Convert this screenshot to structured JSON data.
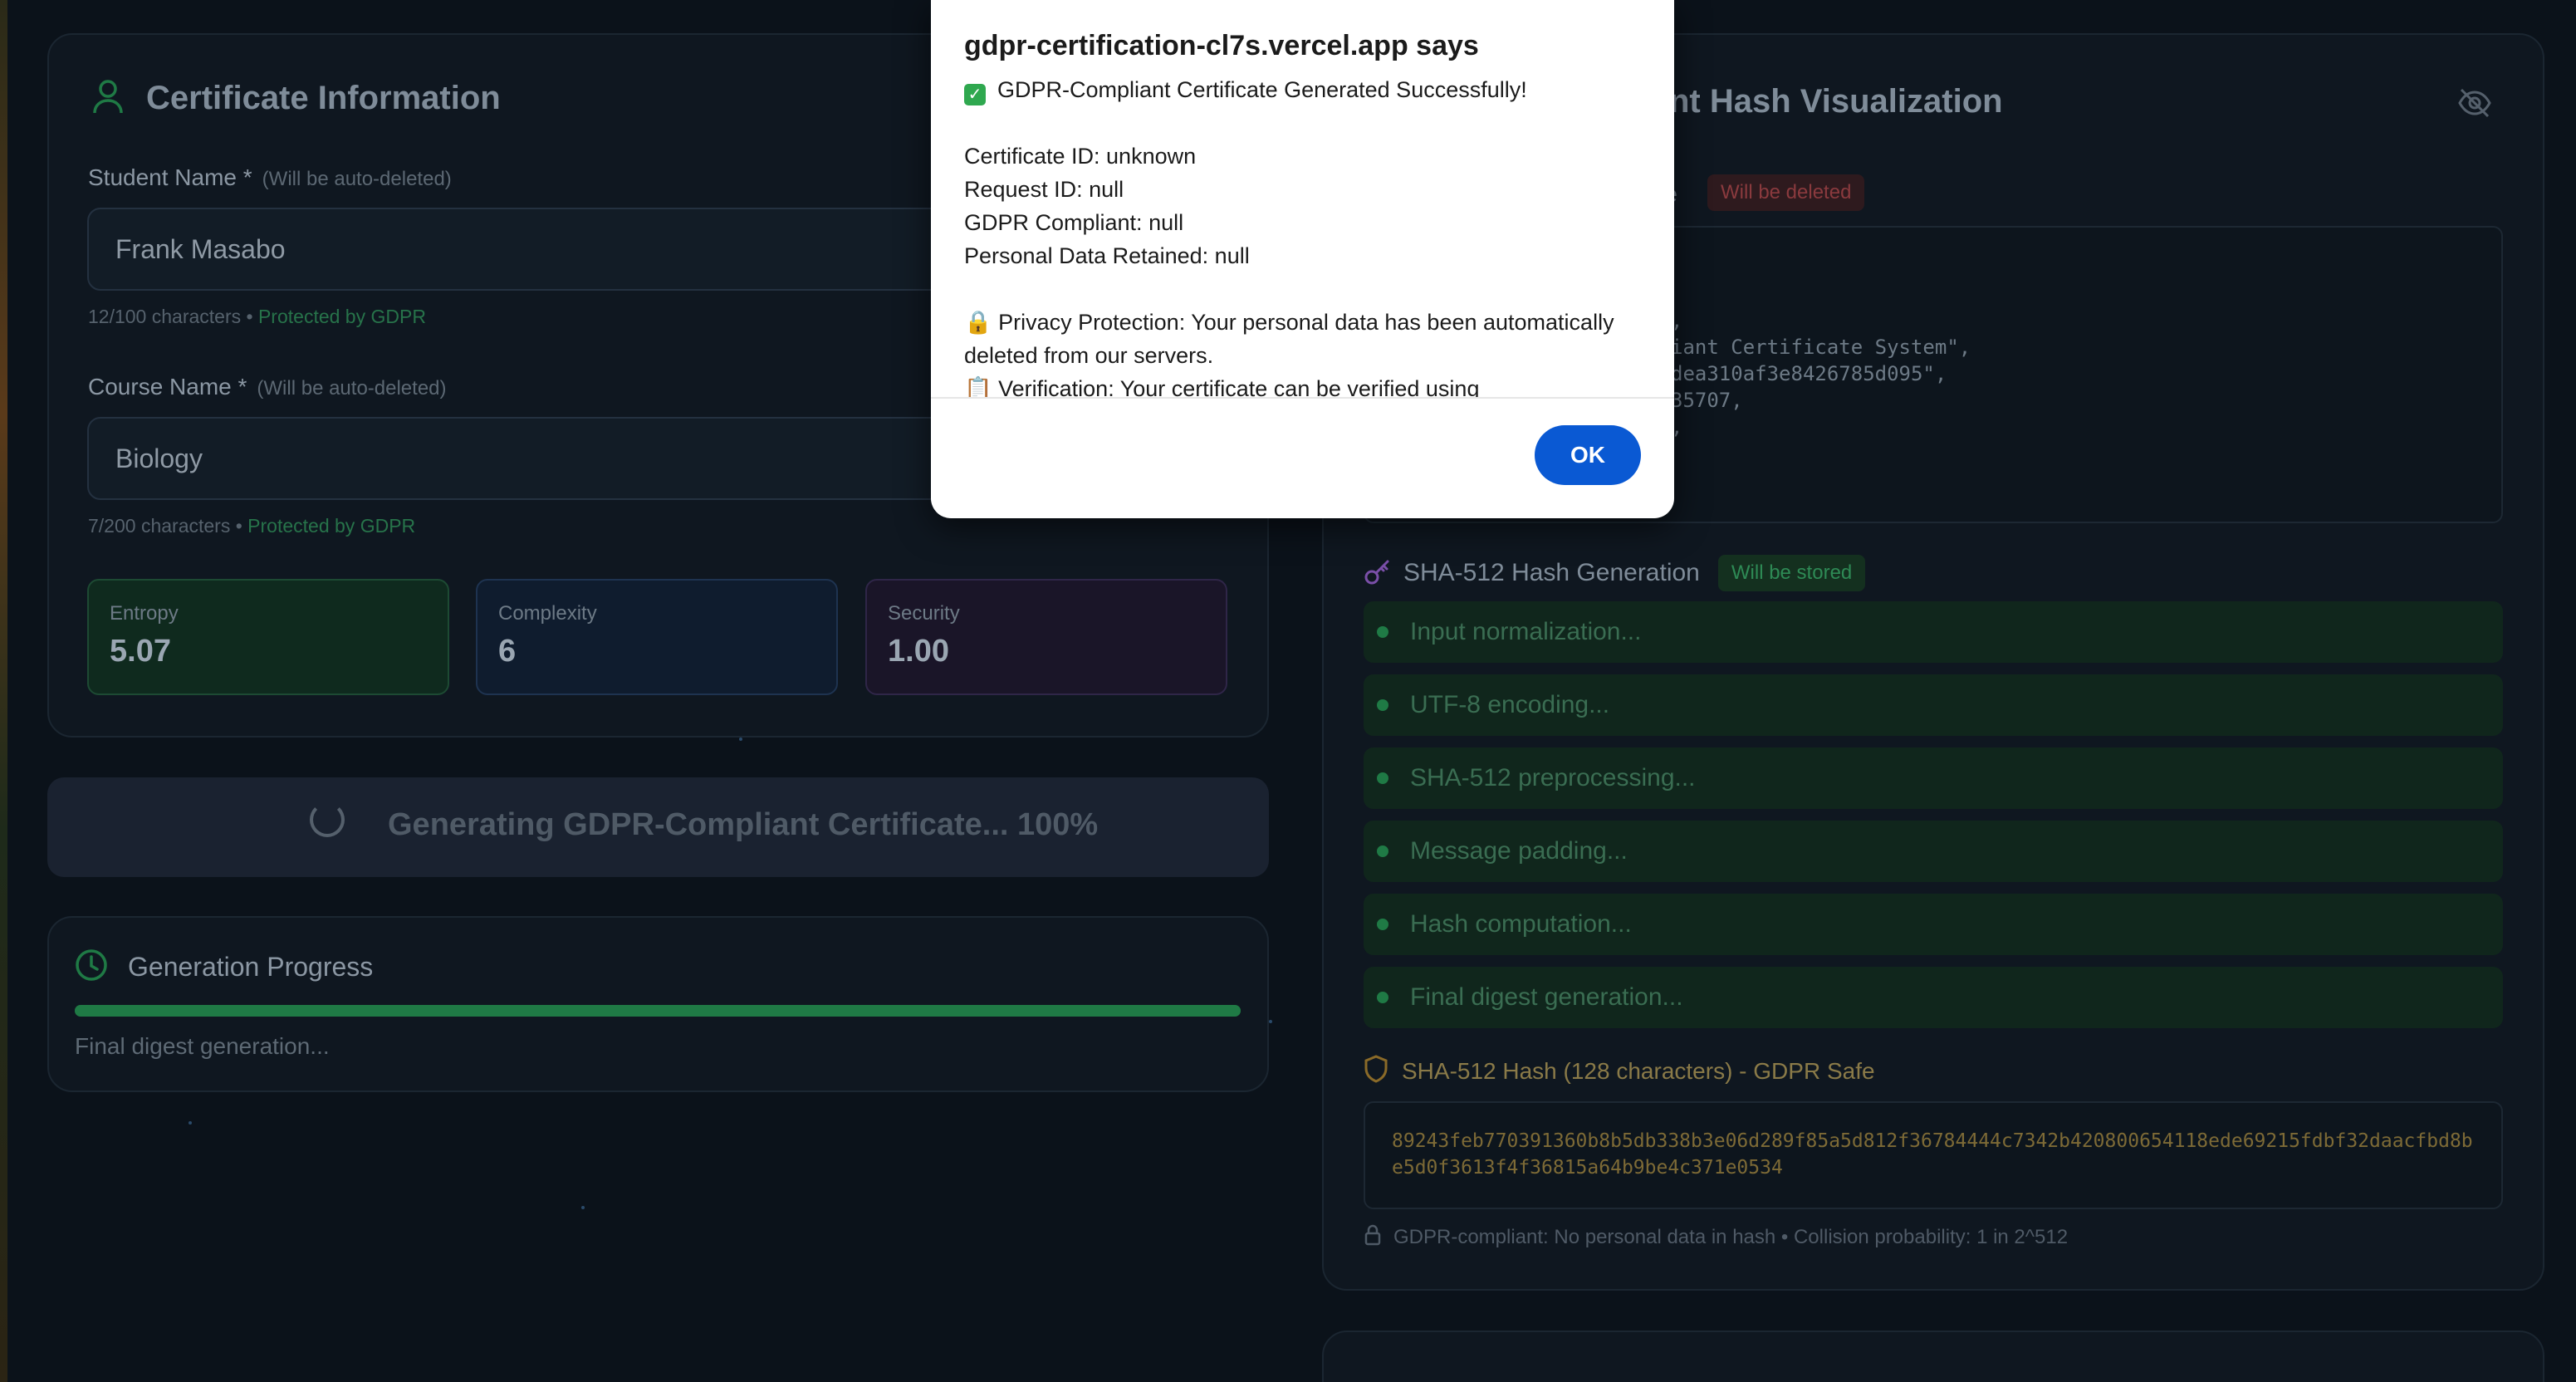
{
  "dialog": {
    "title": "gdpr-certification-cl7s.vercel.app says",
    "success_line": "GDPR-Compliant Certificate Generated Successfully!",
    "lines": [
      "Certificate ID: unknown",
      "Request ID: null",
      "GDPR Compliant: null",
      "Personal Data Retained: null"
    ],
    "privacy_line_1": "🔒 Privacy Protection: Your personal data has been automatically",
    "privacy_line_2": "deleted from our servers.",
    "verification_line": "📋 Verification: Your certificate can be verified using",
    "ok_label": "OK"
  },
  "cert_info": {
    "title": "Certificate Information",
    "student_label": "Student Name *",
    "student_hint": "(Will be auto-deleted)",
    "student_value": "Frank Masabo",
    "student_count": "12/100 characters",
    "student_protect": "Protected by GDPR",
    "course_label": "Course Name *",
    "course_hint": "(Will be auto-deleted)",
    "course_value": "Biology",
    "course_count": "7/200 characters",
    "course_protect": "Protected by GDPR",
    "separator": "•",
    "metrics": [
      {
        "label": "Entropy",
        "value": "5.07"
      },
      {
        "label": "Complexity",
        "value": "6"
      },
      {
        "label": "Security",
        "value": "1.00"
      }
    ]
  },
  "generate_button": {
    "label": "Generating GDPR-Compliant Certificate... 100%"
  },
  "progress": {
    "title": "Generation Progress",
    "status": "Final digest generation...",
    "percent": 100
  },
  "hash_viz": {
    "title_fragment": "nt Hash Visualization",
    "structure_fragment": "re",
    "deleted_badge": "Will be deleted",
    "code_lines": [
      ",",
      "iant Certificate System\",",
      "dea310af3e8426785d095\",",
      "35707,",
      ","
    ],
    "generation_title": "SHA-512 Hash Generation",
    "stored_badge": "Will be stored",
    "steps": [
      "Input normalization...",
      "UTF-8 encoding...",
      "SHA-512 preprocessing...",
      "Message padding...",
      "Hash computation...",
      "Final digest generation..."
    ],
    "hash_title": "SHA-512 Hash (128 characters) - GDPR Safe",
    "hash_value": "89243feb770391360b8b5db338b3e06d289f85a5d812f36784444c7342b420800654118ede69215fdbf32daacfbd8be5d0f3613f4f36815a64b9be4c371e0534",
    "footer_note": "GDPR-compliant: No personal data in hash • Collision probability: 1 in 2^512"
  }
}
